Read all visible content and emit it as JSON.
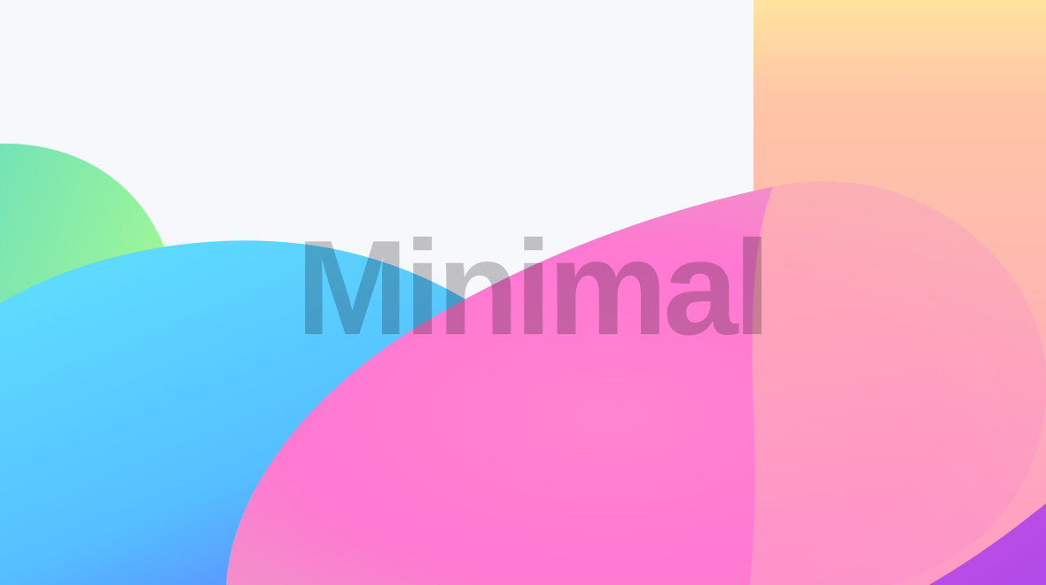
{
  "hero": {
    "title": "Minimal"
  },
  "colors": {
    "background": "#f7f8fb",
    "green": "#8ff0a3",
    "blue": "#5bc9ff",
    "pink": "#ff7dd2",
    "peach": "#ffc0ab",
    "purple": "#b94be2"
  }
}
